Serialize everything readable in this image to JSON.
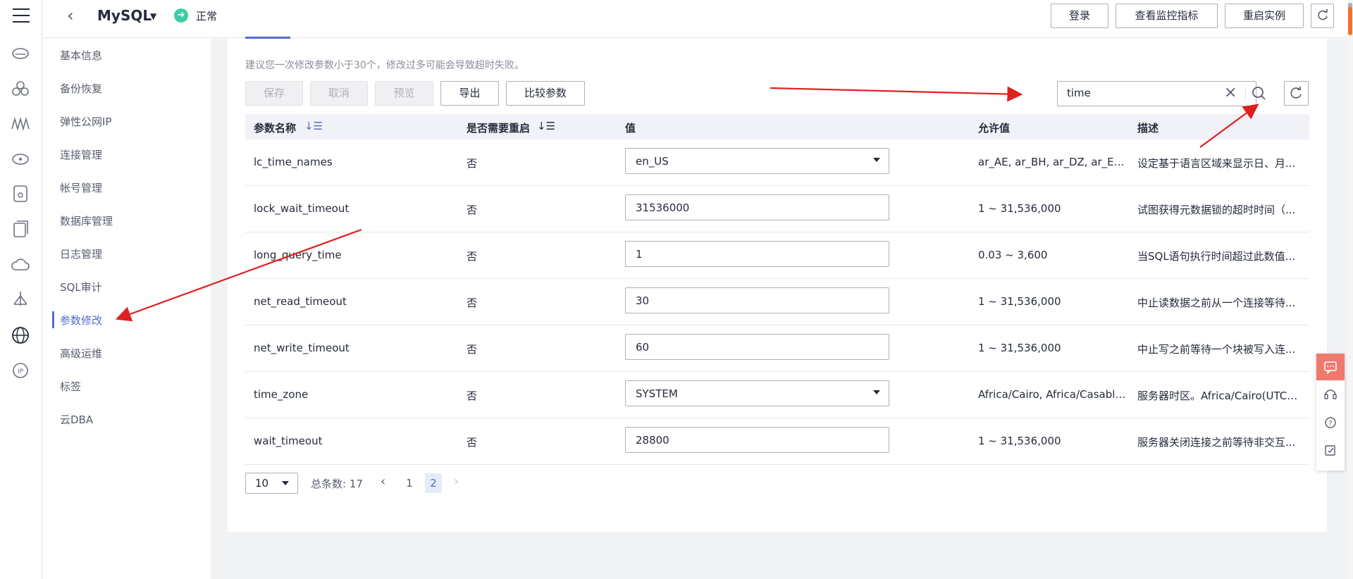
{
  "header": {
    "title": "MySQL",
    "status_icon": "arrow-circle-icon",
    "status": "正常",
    "buttons": [
      "登录",
      "查看监控指标",
      "重启实例"
    ]
  },
  "sidebar": {
    "items": [
      "基本信息",
      "备份恢复",
      "弹性公网IP",
      "连接管理",
      "帐号管理",
      "数据库管理",
      "日志管理",
      "SQL审计",
      "参数修改",
      "高级运维",
      "标签",
      "云DBA"
    ],
    "active": "参数修改"
  },
  "main": {
    "hint": "建议您一次修改参数小于30个，修改过多可能会导致超时失败。",
    "actions": {
      "save": "保存",
      "cancel": "取消",
      "preview": "预览",
      "export": "导出",
      "compare": "比较参数"
    },
    "search": {
      "value": "time"
    },
    "table": {
      "headers": {
        "name": "参数名称",
        "restart": "是否需要重启",
        "value": "值",
        "allowed": "允许值",
        "desc": "描述"
      },
      "rows": [
        {
          "name": "lc_time_names",
          "restart": "否",
          "value": "en_US",
          "type": "select",
          "allowed": "ar_AE, ar_BH, ar_DZ, ar_EG,...",
          "desc": "设定基于语言区域来显示日、月..."
        },
        {
          "name": "lock_wait_timeout",
          "restart": "否",
          "value": "31536000",
          "type": "input",
          "allowed": "1 ~ 31,536,000",
          "desc": "试图获得元数据锁的超时时间（..."
        },
        {
          "name": "long_query_time",
          "restart": "否",
          "value": "1",
          "type": "input",
          "allowed": "0.03 ~ 3,600",
          "desc": "当SQL语句执行时间超过此数值..."
        },
        {
          "name": "net_read_timeout",
          "restart": "否",
          "value": "30",
          "type": "input",
          "allowed": "1 ~ 31,536,000",
          "desc": "中止读数据之前从一个连接等待..."
        },
        {
          "name": "net_write_timeout",
          "restart": "否",
          "value": "60",
          "type": "input",
          "allowed": "1 ~ 31,536,000",
          "desc": "中止写之前等待一个块被写入连..."
        },
        {
          "name": "time_zone",
          "restart": "否",
          "value": "SYSTEM",
          "type": "select",
          "allowed": "Africa/Cairo, Africa/Casabla...",
          "desc": "服务器时区。Africa/Cairo(UTC+..."
        },
        {
          "name": "wait_timeout",
          "restart": "否",
          "value": "28800",
          "type": "input",
          "allowed": "1 ~ 31,536,000",
          "desc": "服务器关闭连接之前等待非交互..."
        }
      ]
    },
    "pagination": {
      "page_size": "10",
      "total": "总条数: 17",
      "pages": [
        "1",
        "2"
      ],
      "current": "2"
    }
  },
  "colors": {
    "accent": "#526ecc",
    "status_ok": "#3dcca6",
    "annotation_arrow": "#e02020"
  }
}
